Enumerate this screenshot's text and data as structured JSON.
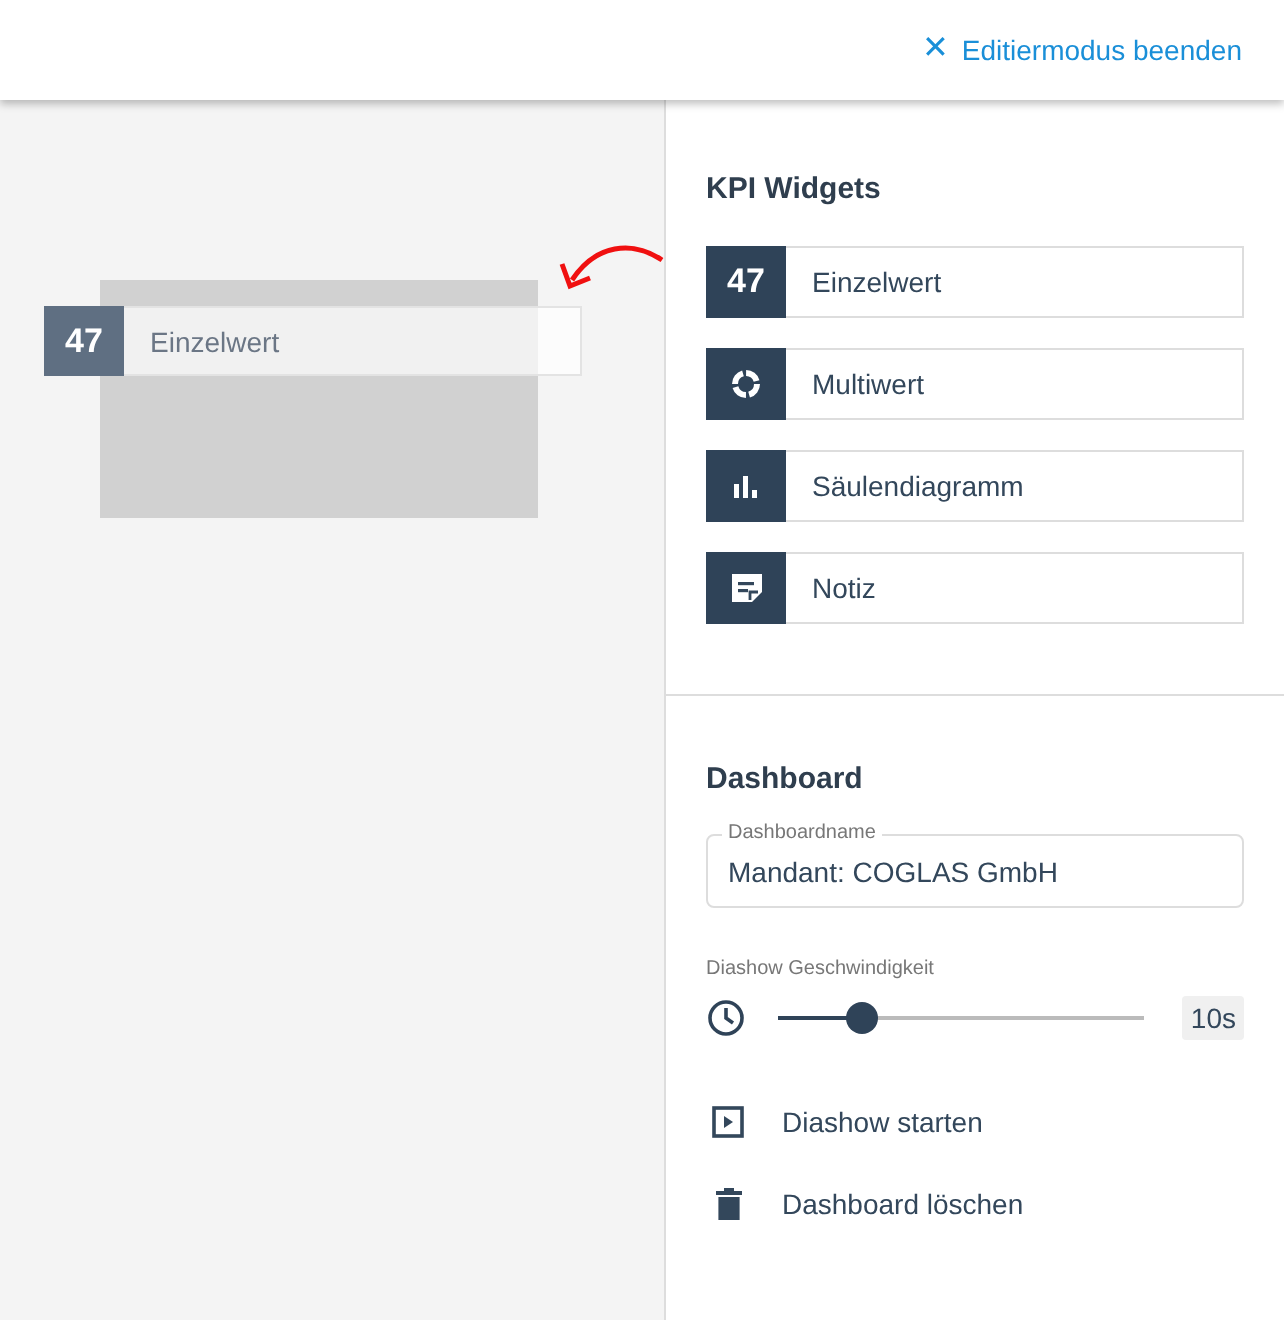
{
  "header": {
    "close_icon_text": "✕",
    "action": "Editiermodus beenden"
  },
  "canvas": {
    "dragged_widget": {
      "kind": "number",
      "badge": "47",
      "label": "Einzelwert"
    }
  },
  "kpi_widgets": {
    "title": "KPI Widgets",
    "items": [
      {
        "kind": "number",
        "badge": "47",
        "label": "Einzelwert"
      },
      {
        "kind": "donut",
        "label": "Multiwert"
      },
      {
        "kind": "bars",
        "label": "Säulendiagramm"
      },
      {
        "kind": "note",
        "label": "Notiz"
      }
    ]
  },
  "dashboard": {
    "title": "Dashboard",
    "name_field": {
      "label": "Dashboardname",
      "value": "Mandant: COGLAS GmbH"
    },
    "speed": {
      "label": "Diashow Geschwindigkeit",
      "level": 0.23,
      "reading": "10s"
    },
    "actions": [
      {
        "kind": "play",
        "label": "Diashow starten"
      },
      {
        "kind": "delete",
        "label": "Dashboard löschen"
      }
    ]
  }
}
